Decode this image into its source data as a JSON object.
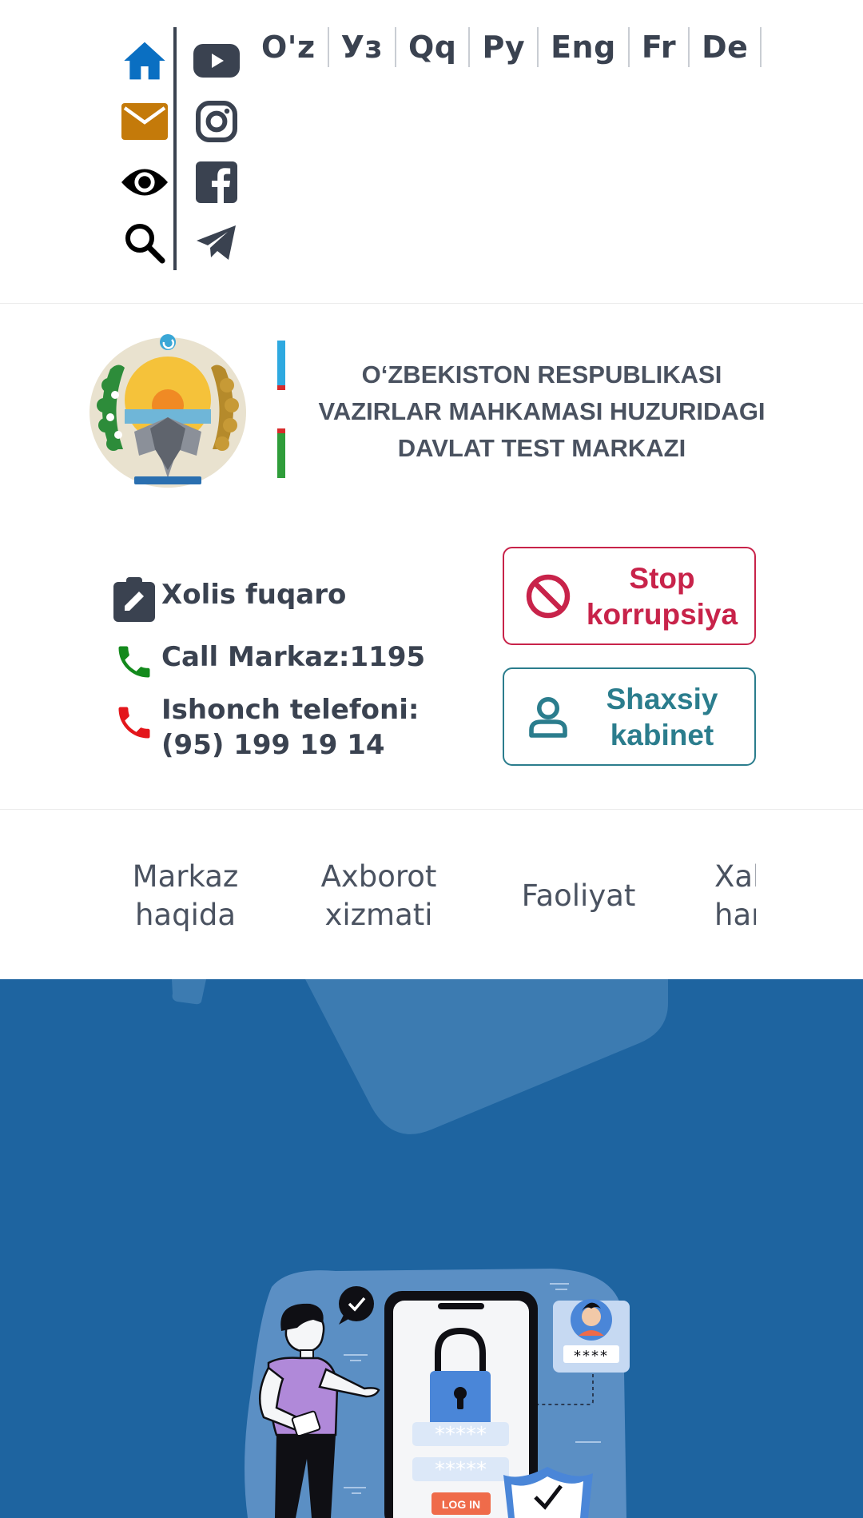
{
  "languages": [
    "O'z",
    "Уз",
    "Qq",
    "Ру",
    "Eng",
    "Fr",
    "De"
  ],
  "top_icons": {
    "left": [
      "home-icon",
      "mail-icon",
      "eye-icon",
      "search-icon"
    ],
    "right": [
      "youtube-icon",
      "instagram-icon",
      "facebook-icon",
      "telegram-icon"
    ]
  },
  "organization": {
    "line1": "O‘ZBEKISTON RESPUBLIKASI",
    "line2": "VAZIRLAR MAHKAMASI HUZURIDAGI",
    "line3": "DAVLAT TEST MARKAZI"
  },
  "contacts": {
    "xolis": "Xolis fuqaro",
    "call": "Call Markaz:1195",
    "trust_label": "Ishonch telefoni:",
    "trust_phone": "(95) 199 19 14"
  },
  "buttons": {
    "stop_line1": "Stop",
    "stop_line2": "korrupsiya",
    "cabinet_line1": "Shaxsiy",
    "cabinet_line2": "kabinet"
  },
  "nav": {
    "item1_line1": "Markaz",
    "item1_line2": "haqida",
    "item2_line1": "Axborot",
    "item2_line2": "xizmati",
    "item3": "Faoliyat",
    "item4_line1": "Xalqaro",
    "item4_line2": "hamkorlik"
  },
  "hero": {
    "password_mask_1": "*****",
    "password_mask_2": "*****",
    "avatar_mask": "****",
    "login_button": "LOG IN"
  },
  "colors": {
    "home": "#0a6fc2",
    "mail": "#c47a0a",
    "stop": "#c8234a",
    "cabinet": "#2b7d8d",
    "hero_bg": "#1e64a0",
    "phone_green": "#138a1c",
    "phone_red": "#e3161b"
  }
}
